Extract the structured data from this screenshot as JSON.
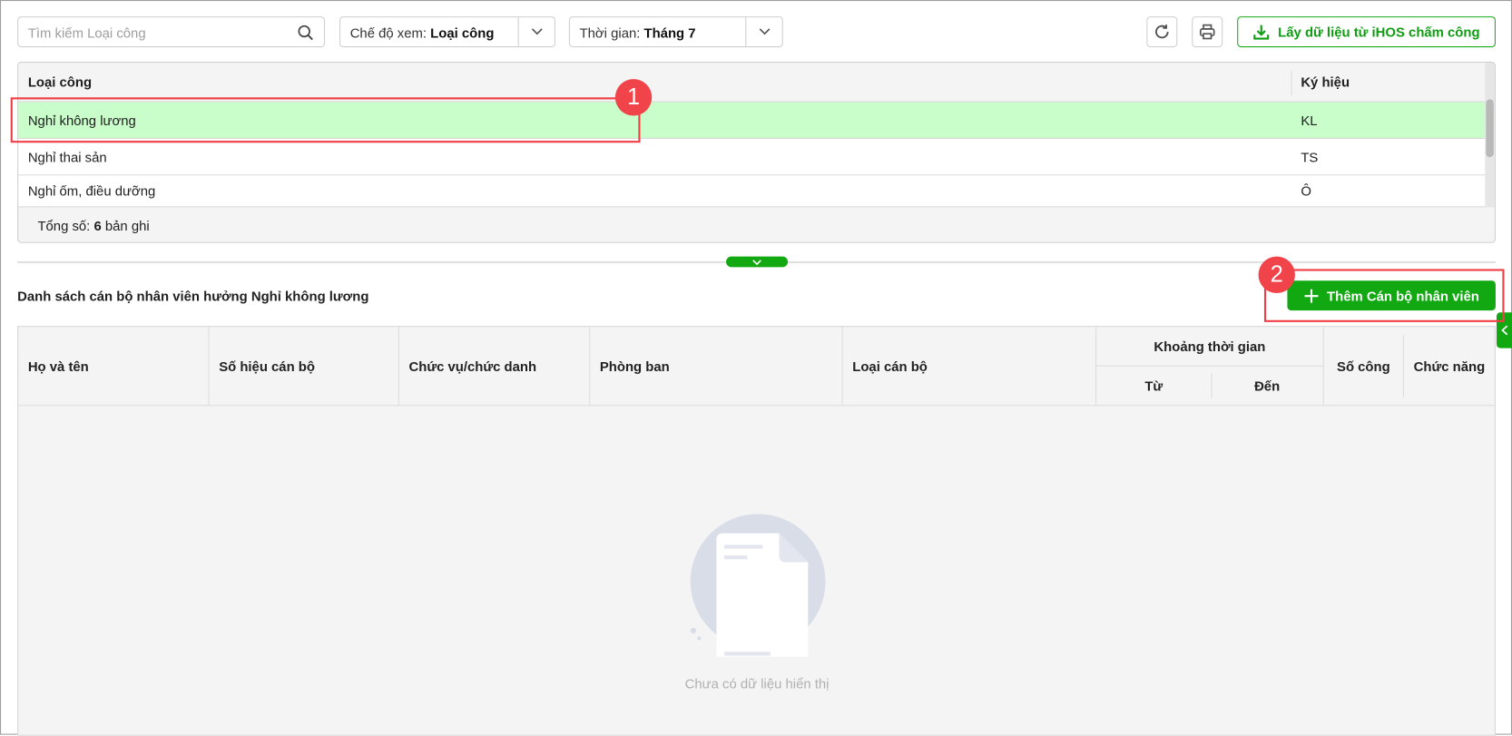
{
  "toolbar": {
    "search_placeholder": "Tìm kiếm Loại công",
    "view_mode_label": "Chế độ xem:",
    "view_mode_value": "Loại công",
    "time_label": "Thời gian:",
    "time_value": "Tháng 7",
    "fetch_label": "Lấy dữ liệu từ iHOS chấm công"
  },
  "types_table": {
    "headers": [
      "Loại công",
      "Ký hiệu"
    ],
    "rows": [
      {
        "name": "Nghỉ không lương",
        "code": "KL"
      },
      {
        "name": "Nghỉ thai sản",
        "code": "TS"
      },
      {
        "name": "Nghỉ ốm, điều dưỡng",
        "code": "Ô"
      }
    ],
    "total_label": "Tổng số:",
    "total_count": "6",
    "total_suffix": "bản ghi"
  },
  "staff_section": {
    "title": "Danh sách cán bộ nhân viên hưởng Nghỉ không lương",
    "add_label": "Thêm Cán bộ nhân viên",
    "headers": {
      "name": "Họ và tên",
      "id": "Số hiệu cán bộ",
      "position": "Chức vụ/chức danh",
      "department": "Phòng ban",
      "type": "Loại cán bộ",
      "period": "Khoảng thời gian",
      "from": "Từ",
      "to": "Đến",
      "days": "Số công",
      "actions": "Chức năng"
    },
    "empty_text": "Chưa có dữ liệu hiển thị"
  },
  "annotations": {
    "one": "1",
    "two": "2"
  },
  "colors": {
    "accent": "#12a812",
    "selected_row": "#c9fdca",
    "callout": "#ef3e45"
  }
}
